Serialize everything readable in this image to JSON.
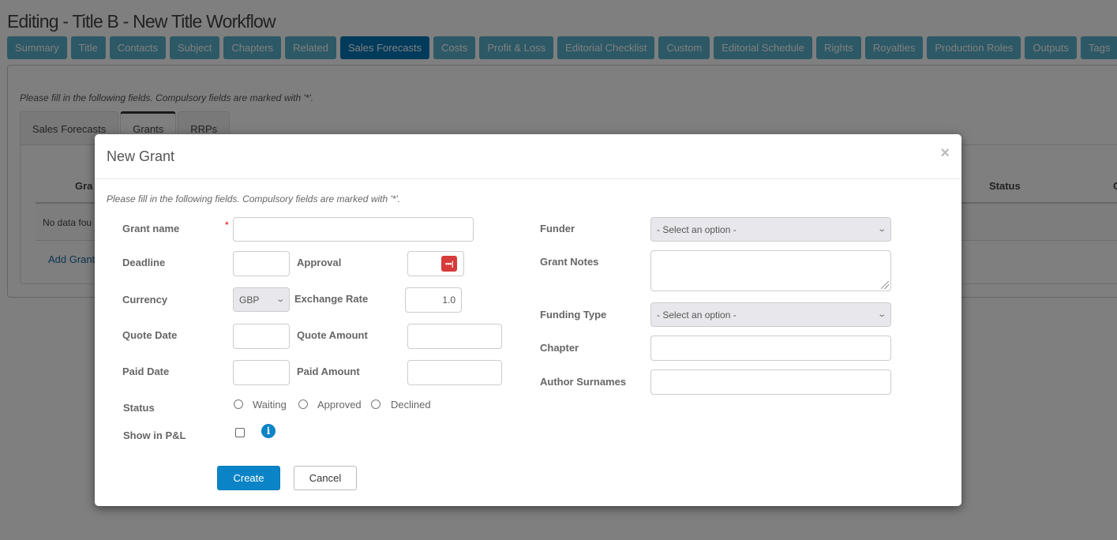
{
  "page": {
    "title": "Editing - Title B - New Title Workflow",
    "instructions": "Please fill in the following fields. Compulsory fields are marked with '*'."
  },
  "nav_tabs": [
    {
      "label": "Summary"
    },
    {
      "label": "Title"
    },
    {
      "label": "Contacts"
    },
    {
      "label": "Subject"
    },
    {
      "label": "Chapters"
    },
    {
      "label": "Related"
    },
    {
      "label": "Sales Forecasts",
      "active": true
    },
    {
      "label": "Costs"
    },
    {
      "label": "Profit & Loss"
    },
    {
      "label": "Editorial Checklist"
    },
    {
      "label": "Custom"
    },
    {
      "label": "Editorial Schedule"
    },
    {
      "label": "Rights"
    },
    {
      "label": "Royalties"
    },
    {
      "label": "Production Roles"
    },
    {
      "label": "Outputs"
    },
    {
      "label": "Tags"
    }
  ],
  "sub_tabs": [
    {
      "label": "Sales Forecasts"
    },
    {
      "label": "Grants",
      "active": true
    },
    {
      "label": "RRPs"
    }
  ],
  "grants_grid": {
    "columns": [
      "Gra",
      "Status",
      "C"
    ],
    "empty_text": "No data fou",
    "add_link": "Add Grant"
  },
  "modal": {
    "title": "New Grant",
    "close_glyph": "×",
    "instructions": "Please fill in the following fields. Compulsory fields are marked with '*'.",
    "required_marker": "*",
    "fields": {
      "grant_name": {
        "label": "Grant name",
        "value": ""
      },
      "deadline": {
        "label": "Deadline",
        "value": ""
      },
      "approval": {
        "label": "Approval",
        "value": ""
      },
      "currency": {
        "label": "Currency",
        "value": "GBP"
      },
      "exchange_rate": {
        "label": "Exchange Rate",
        "value": "1.0"
      },
      "quote_date": {
        "label": "Quote Date",
        "value": ""
      },
      "quote_amount": {
        "label": "Quote Amount",
        "value": ""
      },
      "paid_date": {
        "label": "Paid Date",
        "value": ""
      },
      "paid_amount": {
        "label": "Paid Amount",
        "value": ""
      },
      "status": {
        "label": "Status",
        "options": [
          "Waiting",
          "Approved",
          "Declined"
        ],
        "selected": null
      },
      "show_in_pl": {
        "label": "Show in P&L",
        "checked": false
      },
      "funder": {
        "label": "Funder",
        "value": "- Select an option -"
      },
      "grant_notes": {
        "label": "Grant Notes",
        "value": ""
      },
      "funding_type": {
        "label": "Funding Type",
        "value": "- Select an option -"
      },
      "chapter": {
        "label": "Chapter",
        "value": ""
      },
      "author_surnames": {
        "label": "Author Surnames",
        "value": ""
      }
    },
    "icons": {
      "password_manager": "•••|",
      "info": "i",
      "chevron": "⌄"
    },
    "buttons": {
      "create": "Create",
      "cancel": "Cancel"
    }
  }
}
